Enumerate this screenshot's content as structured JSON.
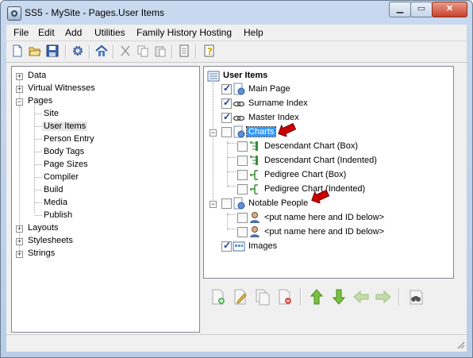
{
  "window": {
    "title": "SS5 - MySite - Pages.User Items"
  },
  "menu": [
    "File",
    "Edit",
    "Add",
    "Utilities",
    "Family History Hosting",
    "Help"
  ],
  "toolbar_icons": [
    "new-file-icon",
    "open-folder-icon",
    "save-icon",
    "settings-gear-icon",
    "home-icon",
    "cut-icon",
    "copy-icon",
    "paste-icon",
    "page-icon",
    "help-icon"
  ],
  "left_tree": {
    "data": "Data",
    "virtual_witnesses": "Virtual Witnesses",
    "pages": "Pages",
    "pages_children": [
      "Site",
      "User Items",
      "Person Entry",
      "Body Tags",
      "Page Sizes",
      "Compiler",
      "Build",
      "Media",
      "Publish"
    ],
    "layouts": "Layouts",
    "stylesheets": "Stylesheets",
    "strings": "Strings"
  },
  "right_tree": {
    "root": "User Items",
    "items": {
      "main_page": "Main Page",
      "surname_index": "Surname Index",
      "master_index": "Master Index",
      "charts": "Charts",
      "descendant_box": "Descendant Chart (Box)",
      "descendant_indented": "Descendant Chart (Indented)",
      "pedigree_box": "Pedigree Chart (Box)",
      "pedigree_indented": "Pedigree Chart (Indented)",
      "notable_people": "Notable People",
      "person1": "<put name here and ID below>",
      "person2": "<put name here and ID below>",
      "images": "Images"
    }
  },
  "colors": {
    "selection": "#3399ff",
    "annotation_arrow": "#cc0000",
    "titlebar": "#c9d9ee"
  }
}
